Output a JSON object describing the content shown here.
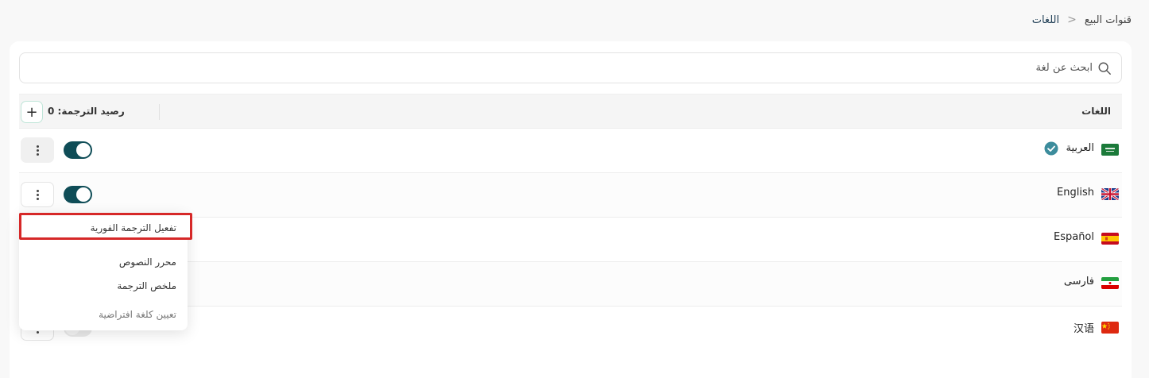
{
  "breadcrumb": {
    "parent": "قنوات البيع",
    "separator": ">",
    "current": "اللغات"
  },
  "search": {
    "placeholder": "ابحث عن لغة",
    "icon": "search-icon"
  },
  "table": {
    "column_languages": "اللغات",
    "translation_balance": "رصيد الترجمة: 0",
    "add_label": "+"
  },
  "languages": [
    {
      "name": "العربية",
      "flag": "saudi-arabia-flag",
      "default": true,
      "enabled": true
    },
    {
      "name": "English",
      "flag": "uk-flag",
      "default": false,
      "enabled": true
    },
    {
      "name": "Español",
      "flag": "spain-flag",
      "default": false,
      "enabled": true
    },
    {
      "name": "فارسى",
      "flag": "iran-flag",
      "default": false,
      "enabled": true
    },
    {
      "name": "汉语",
      "flag": "china-flag",
      "default": false,
      "enabled": false
    }
  ],
  "dropdown_menu": {
    "items": [
      {
        "label": "تفعيل الترجمة الفورية",
        "highlighted": true
      },
      {
        "label": "محرر النصوص"
      },
      {
        "label": "ملخص الترجمة"
      },
      {
        "label": "تعيين كلغة افتراضية",
        "muted": true
      }
    ]
  },
  "colors": {
    "toggle_on": "#0f4d57",
    "verified_badge": "#3c8c9c",
    "highlight_border": "#d62828"
  }
}
